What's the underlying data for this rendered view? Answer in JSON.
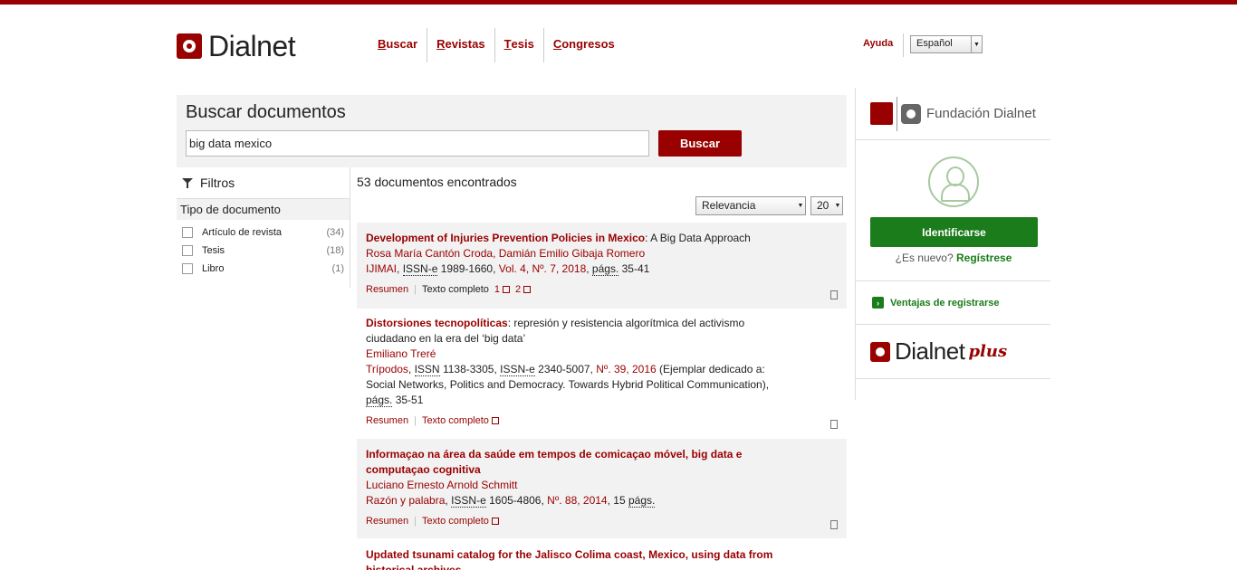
{
  "brand": {
    "name": "Dialnet"
  },
  "nav": {
    "items": [
      {
        "first": "B",
        "rest": "uscar"
      },
      {
        "first": "R",
        "rest": "evistas"
      },
      {
        "first": "T",
        "rest": "esis"
      },
      {
        "first": "C",
        "rest": "ongresos"
      }
    ],
    "help": "Ayuda",
    "language": "Español"
  },
  "search": {
    "heading": "Buscar documentos",
    "query": "big data mexico",
    "button": "Buscar"
  },
  "filters": {
    "title": "Filtros",
    "group": "Tipo de documento",
    "facets": [
      {
        "label": "Artículo de revista",
        "count": "(34)"
      },
      {
        "label": "Tesis",
        "count": "(18)"
      },
      {
        "label": "Libro",
        "count": "(1)"
      }
    ]
  },
  "results": {
    "count_text": "53 documentos encontrados",
    "sort": "Relevancia",
    "per_page": "20",
    "summary_label": "Resumen",
    "fulltext_label": "Texto completo",
    "docs": [
      {
        "title": "Development of Injuries Prevention Policies in Mexico",
        "subtitle": ": A Big Data Approach",
        "authors": "Rosa María Cantón Croda, Damián Emilio Gibaja Romero",
        "journal": "IJIMAI",
        "issn_label": "ISSN-e",
        "issn": "1989-1660,",
        "issue": "Vol. 4, Nº. 7, 2018",
        "pages_label": "págs.",
        "pages": "35-41",
        "links": [
          "1",
          "2"
        ]
      },
      {
        "title": "Distorsiones tecnopolíticas",
        "subtitle": ": represión y resistencia algorítmica del activismo ciudadano en la era del ‘big data’",
        "authors": "Emiliano Treré",
        "journal": "Trípodos",
        "issn_label": "ISSN",
        "issn": "1138-3305,",
        "issn2_label": "ISSN-e",
        "issn2": "2340-5007,",
        "issue": "Nº. 39, 2016",
        "extra": "(Ejemplar dedicado a: Social Networks, Politics and Democracy. Towards Hybrid Political Communication),",
        "pages_label": "págs.",
        "pages": "35-51"
      },
      {
        "title": "Informaçao na área da saúde em tempos de comicaçao móvel, big data e computaçao cognitiva",
        "authors": "Luciano Ernesto Arnold Schmitt",
        "journal": "Razón y palabra",
        "issn_label": "ISSN-e",
        "issn": "1605-4806,",
        "issue": "Nº. 88, 2014",
        "pages": "15",
        "pages_label": "págs."
      },
      {
        "title": "Updated tsunami catalog for the Jalisco Colima coast, Mexico, using data from historical archives"
      }
    ]
  },
  "sidebar": {
    "foundation": "Fundación Dialnet",
    "login": "Identificarse",
    "new_q": "¿Es nuevo?",
    "register": "Regístrese",
    "benefits": "Ventajas de registrarse",
    "plus_name": "Dialnet",
    "plus_suffix": "plus"
  }
}
